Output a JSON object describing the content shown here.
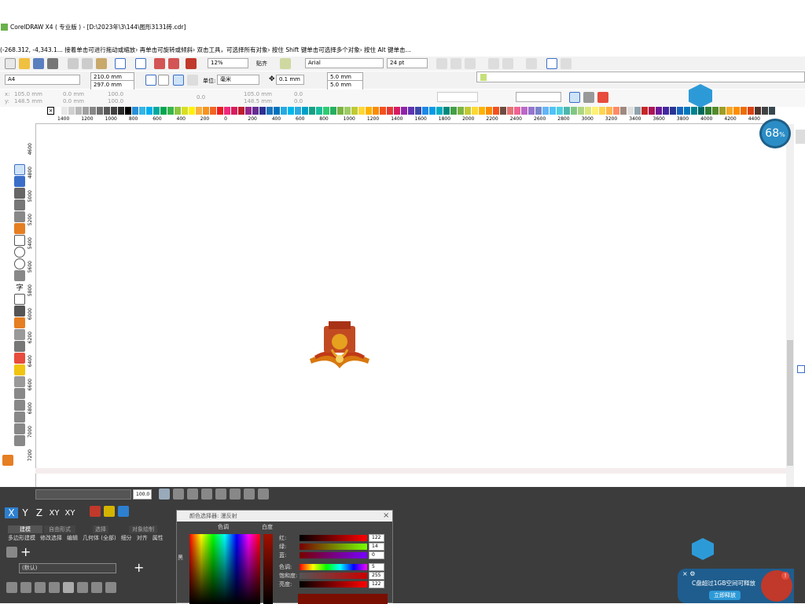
{
  "window": {
    "title": "CorelDRAW X4 ( 专业版 ) - [D:\\2023年\\3\\144\\图形3131砖.cdr]"
  },
  "status": {
    "hint": "(-268.312, -4,343.1... 接着单击可进行拖动或缩放› 再单击可旋转或倾斜› 双击工具，可选择所有对象› 按住 Shift 键单击可选择多个对象› 按住 Alt 键单击..."
  },
  "toolbar": {
    "zoom": "12%",
    "snap_label": "贴齐",
    "font": "Arial",
    "font_size": "24 pt"
  },
  "property_bar": {
    "paper": "A4",
    "width": "210.0 mm",
    "height": "297.0 mm",
    "unit_label": "单位:",
    "unit": "毫米",
    "nudge": "0.1 mm",
    "dup_x": "5.0 mm",
    "dup_y": "5.0 mm"
  },
  "transform_bar": {
    "x_label": "x:",
    "x": "105.0 mm",
    "y_label": "y:",
    "y": "148.5 mm",
    "w1": "0.0 mm",
    "w2": "0.0 mm",
    "s1": "100.0",
    "s2": "100.0",
    "rot": "0.0",
    "pos_x": "105.0 mm",
    "pos_y": "148.5 mm",
    "v1": "0.0",
    "v2": "0.0"
  },
  "ruler": {
    "h_ticks": [
      "1400",
      "1200",
      "1000",
      "800",
      "600",
      "400",
      "200",
      "0",
      "200",
      "400",
      "600",
      "800",
      "1000",
      "1200",
      "1400",
      "1600",
      "1800",
      "2000",
      "2200",
      "2400",
      "2600",
      "2800",
      "3000",
      "3200",
      "3400",
      "3600",
      "3800",
      "4000",
      "4200",
      "4400"
    ],
    "v_ticks": [
      "4600",
      "4800",
      "5000",
      "5200",
      "5400",
      "5600",
      "5800",
      "6000",
      "6200",
      "6400",
      "6600",
      "6800",
      "7000",
      "7200"
    ]
  },
  "palette": [
    "#ffffff",
    "#e8e8e8",
    "#d0d0d0",
    "#b8b8b8",
    "#a0a0a0",
    "#888888",
    "#707070",
    "#585858",
    "#404040",
    "#282828",
    "#000000",
    "#2a8fd6",
    "#33b5e5",
    "#00aeef",
    "#00a99d",
    "#00a651",
    "#39b54a",
    "#8dc63f",
    "#d7df23",
    "#fff200",
    "#fbb040",
    "#f7941d",
    "#f26522",
    "#ed1c24",
    "#ee2a7b",
    "#d91c5c",
    "#be1e2d",
    "#92278f",
    "#662d91",
    "#2e3192",
    "#1b75bc",
    "#0072bc",
    "#27aae1",
    "#00b7eb",
    "#29abe2",
    "#00a0c6",
    "#16a085",
    "#1abc9c",
    "#2ecc71",
    "#27ae60",
    "#7cb342",
    "#9ccc65",
    "#c0ca33",
    "#fdd835",
    "#ffb300",
    "#fb8c00",
    "#f4511e",
    "#e53935",
    "#d81b60",
    "#8e24aa",
    "#5e35b1",
    "#3949ab",
    "#1e88e5",
    "#039be5",
    "#00acc1",
    "#00897b",
    "#43a047",
    "#7cb342",
    "#c0ca33",
    "#fdd835",
    "#ffb300",
    "#fb8c00",
    "#f4511e",
    "#6d4c41",
    "#e57373",
    "#f06292",
    "#ba68c8",
    "#9575cd",
    "#7986cb",
    "#64b5f6",
    "#4fc3f7",
    "#4dd0e1",
    "#4db6ac",
    "#81c784",
    "#aed581",
    "#dce775",
    "#fff176",
    "#ffd54f",
    "#ffb74d",
    "#ff8a65",
    "#a1887f",
    "#e0e0e0",
    "#90a4ae",
    "#c62828",
    "#ad1457",
    "#6a1b9a",
    "#4527a0",
    "#283593",
    "#1565c0",
    "#0277bd",
    "#00838f",
    "#00695c",
    "#2e7d32",
    "#558b2f",
    "#9e9d24",
    "#f9a825",
    "#ff8f00",
    "#ef6c00",
    "#d84315",
    "#4e342e",
    "#424242",
    "#37474f"
  ],
  "badge": {
    "percent": "68",
    "unit": "%"
  },
  "dock": {
    "style_name": "(默认)",
    "outline_value": "100.0",
    "tabs": [
      "建模",
      "自由形式",
      "选择",
      "对象绘制"
    ],
    "menu": [
      "多边形建模",
      "修改选择",
      "编辑",
      "几何体 (全部)",
      "细分",
      "对齐",
      "属性"
    ],
    "axes": [
      "X",
      "Y",
      "Z",
      "XY",
      "XY"
    ]
  },
  "color_picker": {
    "title": "颜色选择器: 漫反射",
    "hue_label": "色调",
    "white_label": "白度",
    "black_label": "黑",
    "red_label": "红:",
    "red": "122",
    "green_label": "绿:",
    "green": "14",
    "blue_label": "蓝:",
    "blue": "0",
    "hue2_label": "色调:",
    "hue2": "5",
    "sat_label": "饱和度:",
    "sat": "255",
    "val_label": "亮度:",
    "val": "122"
  },
  "notify": {
    "message": "C盘超过1GB空间可释放",
    "button": "立即释放",
    "flag": "!"
  },
  "colors": {
    "accent": "#2d9ad8",
    "dark_panel": "#3c3c3c",
    "picker_red": "#7a0e00"
  }
}
